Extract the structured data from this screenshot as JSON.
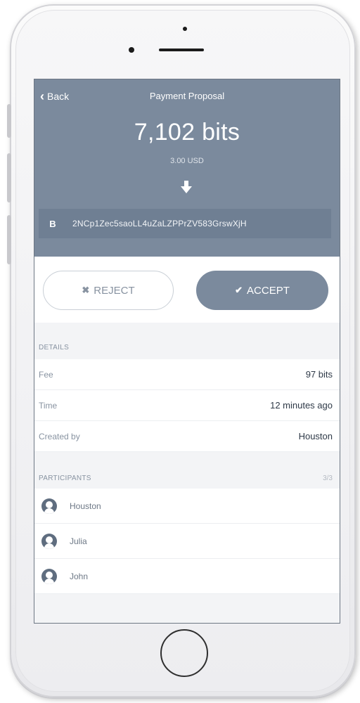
{
  "header": {
    "back_label": "Back",
    "title": "Payment Proposal",
    "amount": "7,102 bits",
    "fiat_amount": "3.00 USD",
    "address_icon": "B",
    "address": "2NCp1Zec5saoLL4uZaLZPPrZV583GrswXjH"
  },
  "actions": {
    "reject_label": "REJECT",
    "reject_icon": "✖",
    "accept_label": "ACCEPT",
    "accept_icon": "✔"
  },
  "details": {
    "section_label": "DETAILS",
    "rows": [
      {
        "label": "Fee",
        "value": "97 bits"
      },
      {
        "label": "Time",
        "value": "12 minutes ago"
      },
      {
        "label": "Created by",
        "value": "Houston"
      }
    ]
  },
  "participants": {
    "section_label": "PARTICIPANTS",
    "count": "3/3",
    "items": [
      {
        "name": "Houston"
      },
      {
        "name": "Julia"
      },
      {
        "name": "John"
      }
    ]
  },
  "colors": {
    "header_bg": "#7b8a9d",
    "address_bar_bg": "#6f7f93",
    "accept_bg": "#7b8a9d",
    "screen_bg": "#f3f4f6"
  }
}
